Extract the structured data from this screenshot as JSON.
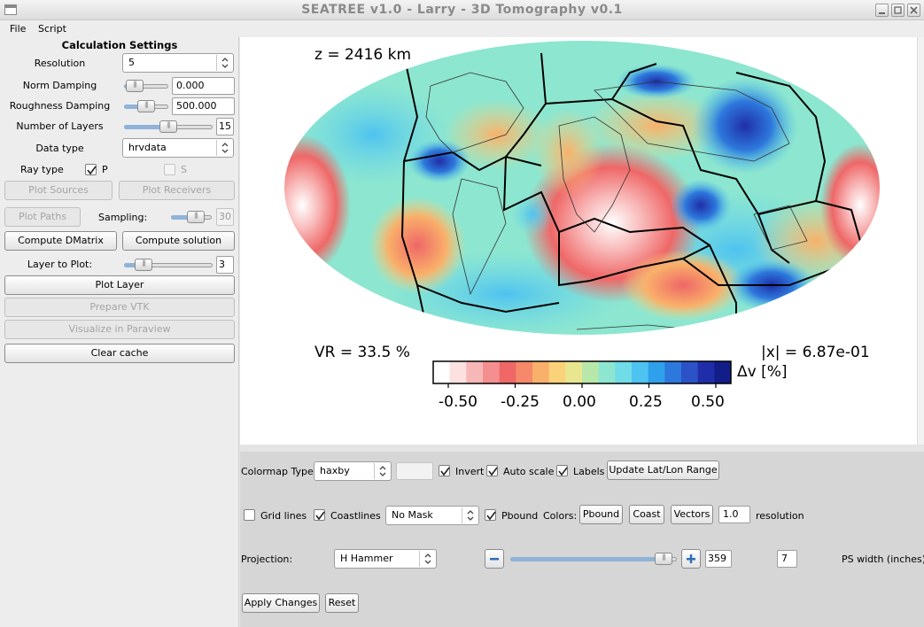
{
  "window": {
    "title": "SEATREE v1.0 - Larry - 3D Tomography v0.1"
  },
  "menu": {
    "file": "File",
    "script": "Script"
  },
  "settings": {
    "heading": "Calculation Settings",
    "resolution_label": "Resolution",
    "resolution_value": "5",
    "norm_damping_label": "Norm Damping",
    "norm_damping_value": "0.000",
    "roughness_label": "Roughness Damping",
    "roughness_value": "500.000",
    "layers_label": "Number of Layers",
    "layers_value": "15",
    "datatype_label": "Data type",
    "datatype_value": "hrvdata",
    "raytype_label": "Ray type",
    "ray_p": "P",
    "ray_s": "S",
    "plot_sources": "Plot Sources",
    "plot_receivers": "Plot Receivers",
    "plot_paths": "Plot Paths",
    "sampling_label": "Sampling:",
    "sampling_value": "30",
    "compute_dmatrix": "Compute DMatrix",
    "compute_solution": "Compute solution",
    "layer_to_plot_label": "Layer to Plot:",
    "layer_to_plot_value": "3",
    "plot_layer": "Plot Layer",
    "prepare_vtk": "Prepare VTK",
    "visualize_paraview": "Visualize in Paraview",
    "clear_cache": "Clear cache",
    "norm_damping_level": 0.05,
    "roughness_level": 0.5,
    "layers_level": 0.5,
    "sampling_level": 0.7,
    "layer_to_plot_level": 0.15
  },
  "plot": {
    "depth_label": "z = 2416 km",
    "vr_label": "VR = 33.5 %",
    "norm_label": "|x| = 6.87e-01",
    "colorbar_unit": "Δv [%]",
    "colorbar_ticks": [
      "-0.50",
      "-0.25",
      "0.00",
      "0.25",
      "0.50"
    ],
    "colorbar_colors": [
      "#ffffff",
      "#fde0e0",
      "#f8b7b7",
      "#f58f8f",
      "#ef6767",
      "#f5896a",
      "#f9b06a",
      "#fbd27a",
      "#e9e690",
      "#b8e8a9",
      "#8de6cf",
      "#6fdce8",
      "#4ec2f0",
      "#2ea0ec",
      "#2d78dc",
      "#2b52c6",
      "#1f2ea8",
      "#121d8a"
    ]
  },
  "controls": {
    "colormap_label": "Colormap Type:",
    "colormap_value": "haxby",
    "invert": "Invert",
    "autoscale": "Auto scale",
    "labels": "Labels",
    "update_range": "Update Lat/Lon Range",
    "gridlines": "Grid lines",
    "coastlines": "Coastlines",
    "mask_value": "No Mask",
    "pbound": "Pbound",
    "colors_label": "Colors:",
    "pbound_btn": "Pbound",
    "coast_btn": "Coast",
    "vectors_btn": "Vectors",
    "resolution_value": "1.0",
    "resolution_label": "resolution",
    "projection_label": "Projection:",
    "projection_value": "H Hammer",
    "lon_value": "359",
    "lon_level": 0.97,
    "ps_value": "7",
    "ps_label": "PS width (inches)",
    "apply": "Apply Changes",
    "reset": "Reset"
  }
}
